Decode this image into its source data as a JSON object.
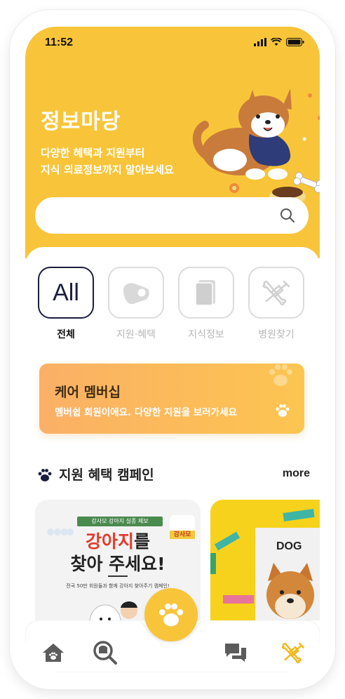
{
  "status_bar": {
    "time": "11:52"
  },
  "hero": {
    "title": "정보마당",
    "subtitle_line1": "다양한 혜택과 지원부터",
    "subtitle_line2": "지식 의료정보까지 알아보세요"
  },
  "search": {
    "placeholder": ""
  },
  "categories": [
    {
      "label": "전체",
      "icon_text": "All",
      "active": true
    },
    {
      "label": "지원·혜택",
      "icon": "pet-tag-icon",
      "active": false
    },
    {
      "label": "지식정보",
      "icon": "book-icon",
      "active": false
    },
    {
      "label": "병원찾기",
      "icon": "syringe-bone-icon",
      "active": false
    }
  ],
  "membership_banner": {
    "title": "케어 멤버십",
    "subtitle": "멤버쉽 회원이에요. 다양한 지원을 보러가세요"
  },
  "campaign_section": {
    "title": "지원 혜택 캠페인",
    "more_label": "more",
    "cards": [
      {
        "tag": "강사모 강아지 실종 제보",
        "headline_highlight": "강아지",
        "headline_rest": "를",
        "headline_line2": "찾아 주세요!",
        "caption": "전국 50만 회원들과 함께 강아지 찾아주기 캠페인!",
        "badge": "강사모"
      },
      {
        "label": "DOG"
      }
    ]
  },
  "tab_bar": {
    "items": [
      "home-icon",
      "search-pet-icon",
      "paw-icon",
      "chat-icon",
      "syringe-bone-icon"
    ]
  },
  "colors": {
    "accent_yellow": "#f8c53a",
    "navy": "#1b1d3f",
    "highlight_red": "#e23a2a"
  }
}
